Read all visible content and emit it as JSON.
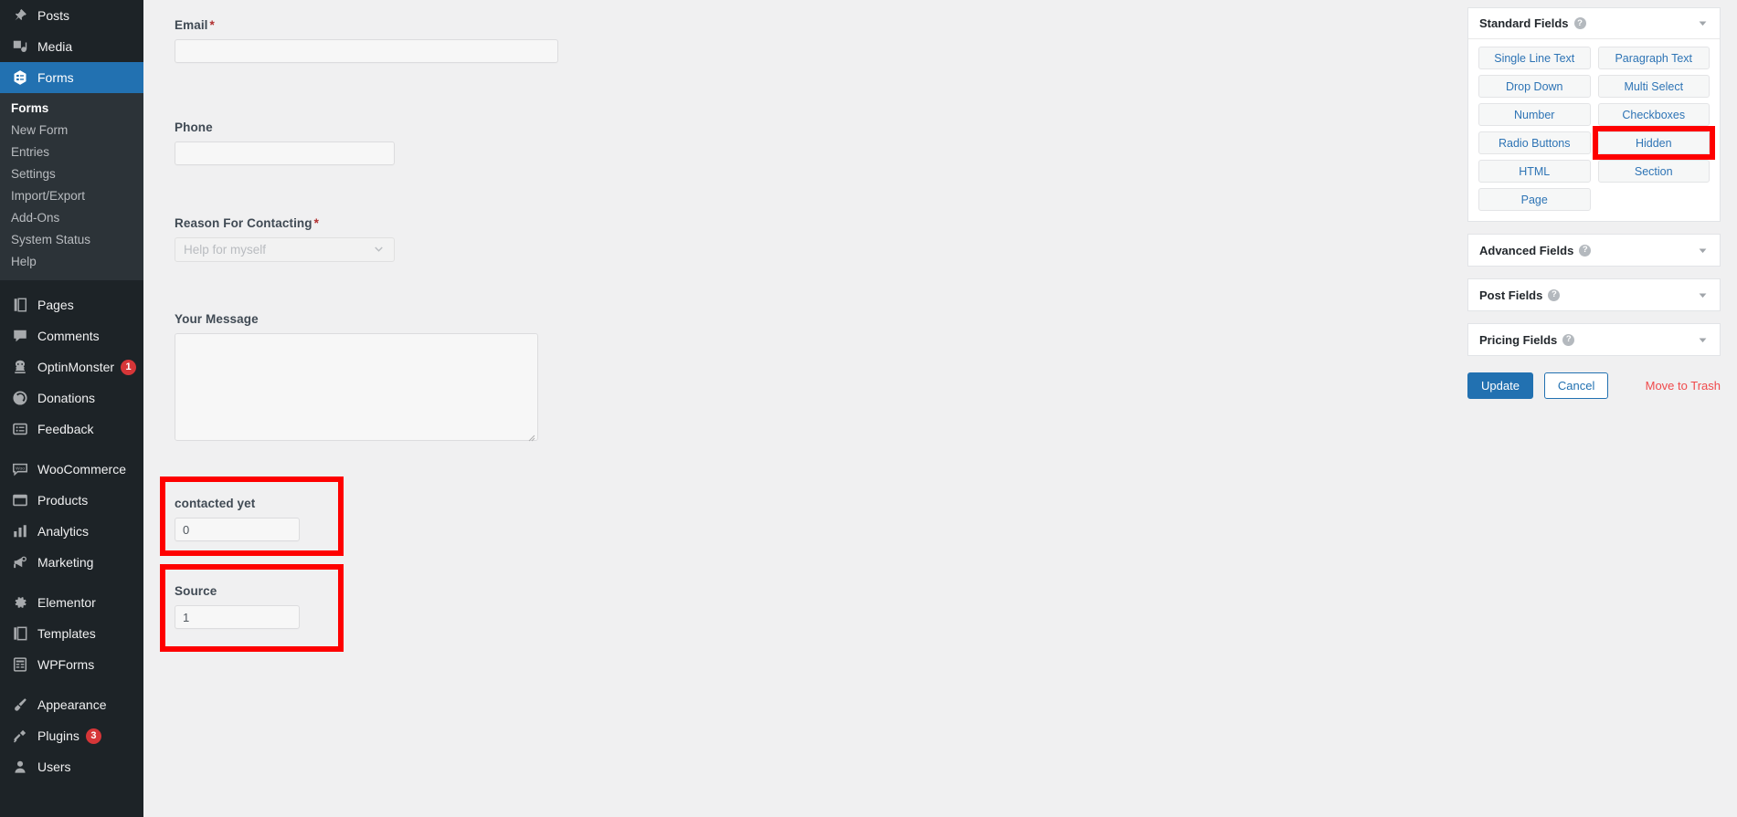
{
  "sidebar": {
    "items": [
      {
        "label": "Posts",
        "icon": "pin-icon",
        "badge": null,
        "current": false,
        "separator_before": false
      },
      {
        "label": "Media",
        "icon": "media-icon",
        "badge": null,
        "current": false,
        "separator_before": false
      },
      {
        "label": "Forms",
        "icon": "forms-icon",
        "badge": null,
        "current": true,
        "separator_before": false
      },
      {
        "label": "Pages",
        "icon": "pages-icon",
        "badge": null,
        "current": false,
        "separator_before": true
      },
      {
        "label": "Comments",
        "icon": "comments-icon",
        "badge": null,
        "current": false,
        "separator_before": false
      },
      {
        "label": "OptinMonster",
        "icon": "optinmonster-icon",
        "badge": "1",
        "current": false,
        "separator_before": false
      },
      {
        "label": "Donations",
        "icon": "donations-icon",
        "badge": null,
        "current": false,
        "separator_before": false
      },
      {
        "label": "Feedback",
        "icon": "feedback-icon",
        "badge": null,
        "current": false,
        "separator_before": false
      },
      {
        "label": "WooCommerce",
        "icon": "woocommerce-icon",
        "badge": null,
        "current": false,
        "separator_before": true
      },
      {
        "label": "Products",
        "icon": "products-icon",
        "badge": null,
        "current": false,
        "separator_before": false
      },
      {
        "label": "Analytics",
        "icon": "analytics-icon",
        "badge": null,
        "current": false,
        "separator_before": false
      },
      {
        "label": "Marketing",
        "icon": "marketing-icon",
        "badge": null,
        "current": false,
        "separator_before": false
      },
      {
        "label": "Elementor",
        "icon": "gear-icon",
        "badge": null,
        "current": false,
        "separator_before": true
      },
      {
        "label": "Templates",
        "icon": "templates-icon",
        "badge": null,
        "current": false,
        "separator_before": false
      },
      {
        "label": "WPForms",
        "icon": "wpforms-icon",
        "badge": null,
        "current": false,
        "separator_before": false
      },
      {
        "label": "Appearance",
        "icon": "brush-icon",
        "badge": null,
        "current": false,
        "separator_before": true
      },
      {
        "label": "Plugins",
        "icon": "plug-icon",
        "badge": "3",
        "current": false,
        "separator_before": false
      },
      {
        "label": "Users",
        "icon": "user-icon",
        "badge": null,
        "current": false,
        "separator_before": false
      }
    ],
    "submenu": [
      {
        "label": "Forms",
        "current": true
      },
      {
        "label": "New Form",
        "current": false
      },
      {
        "label": "Entries",
        "current": false
      },
      {
        "label": "Settings",
        "current": false
      },
      {
        "label": "Import/Export",
        "current": false
      },
      {
        "label": "Add-Ons",
        "current": false
      },
      {
        "label": "System Status",
        "current": false
      },
      {
        "label": "Help",
        "current": false
      }
    ]
  },
  "form_fields": {
    "email": {
      "label": "Email",
      "required_marker": "*",
      "value": "",
      "placeholder": ""
    },
    "phone": {
      "label": "Phone",
      "required_marker": "",
      "value": "",
      "placeholder": ""
    },
    "reason": {
      "label": "Reason For Contacting",
      "required_marker": "*",
      "selected": "Help for myself"
    },
    "message": {
      "label": "Your Message",
      "value": ""
    },
    "contacted_yet": {
      "label": "contacted yet",
      "value": "0",
      "highlighted": true
    },
    "source": {
      "label": "Source",
      "value": "1",
      "highlighted": true
    }
  },
  "right_panel": {
    "standard_fields": {
      "title": "Standard Fields",
      "help_glyph": "?",
      "expanded": true,
      "buttons": [
        {
          "label": "Single Line Text",
          "highlighted": false
        },
        {
          "label": "Paragraph Text",
          "highlighted": false
        },
        {
          "label": "Drop Down",
          "highlighted": false
        },
        {
          "label": "Multi Select",
          "highlighted": false
        },
        {
          "label": "Number",
          "highlighted": false
        },
        {
          "label": "Checkboxes",
          "highlighted": false
        },
        {
          "label": "Radio Buttons",
          "highlighted": false
        },
        {
          "label": "Hidden",
          "highlighted": true
        },
        {
          "label": "HTML",
          "highlighted": false
        },
        {
          "label": "Section",
          "highlighted": false
        },
        {
          "label": "Page",
          "highlighted": false
        }
      ]
    },
    "collapsed_panels": [
      {
        "title": "Advanced Fields",
        "help_glyph": "?"
      },
      {
        "title": "Post Fields",
        "help_glyph": "?"
      },
      {
        "title": "Pricing Fields",
        "help_glyph": "?"
      }
    ],
    "actions": {
      "update_label": "Update",
      "cancel_label": "Cancel",
      "trash_label": "Move to Trash"
    }
  },
  "colors": {
    "sidebar_bg": "#1d2327",
    "submenu_bg": "#2c3338",
    "accent_blue": "#2271b1",
    "badge_red": "#d63638",
    "trash_red": "#f04a4c",
    "annotation_red": "#fe0000",
    "page_bg": "#f0f0f1"
  }
}
